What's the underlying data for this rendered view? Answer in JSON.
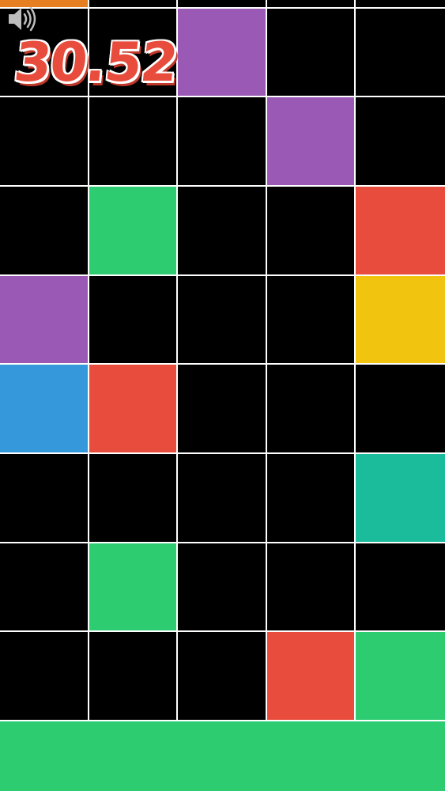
{
  "game": {
    "timer": "30.52",
    "sound": {
      "icon": "speaker-icon",
      "state": "on"
    }
  },
  "colors": {
    "background": "#000000",
    "grid_line": "#ffffff",
    "purple": "#9b59b6",
    "green": "#2ecc71",
    "red": "#e74c3c",
    "yellow": "#f1c40f",
    "blue": "#3498db",
    "teal": "#1abc9c",
    "orange": "#e67e22",
    "bottom_bar": "#2ecc71",
    "timer_text": "#e74c3c"
  },
  "board": {
    "columns": 5,
    "rows": [
      [
        "orange",
        "black",
        "black",
        "black",
        "black"
      ],
      [
        "black",
        "black",
        "purple",
        "black",
        "black"
      ],
      [
        "black",
        "black",
        "black",
        "purple",
        "black"
      ],
      [
        "black",
        "green",
        "black",
        "black",
        "red"
      ],
      [
        "purple",
        "black",
        "black",
        "black",
        "yellow"
      ],
      [
        "blue",
        "red",
        "black",
        "black",
        "black"
      ],
      [
        "black",
        "black",
        "black",
        "black",
        "teal"
      ],
      [
        "black",
        "green",
        "black",
        "black",
        "black"
      ],
      [
        "black",
        "black",
        "black",
        "red",
        "green"
      ]
    ]
  }
}
